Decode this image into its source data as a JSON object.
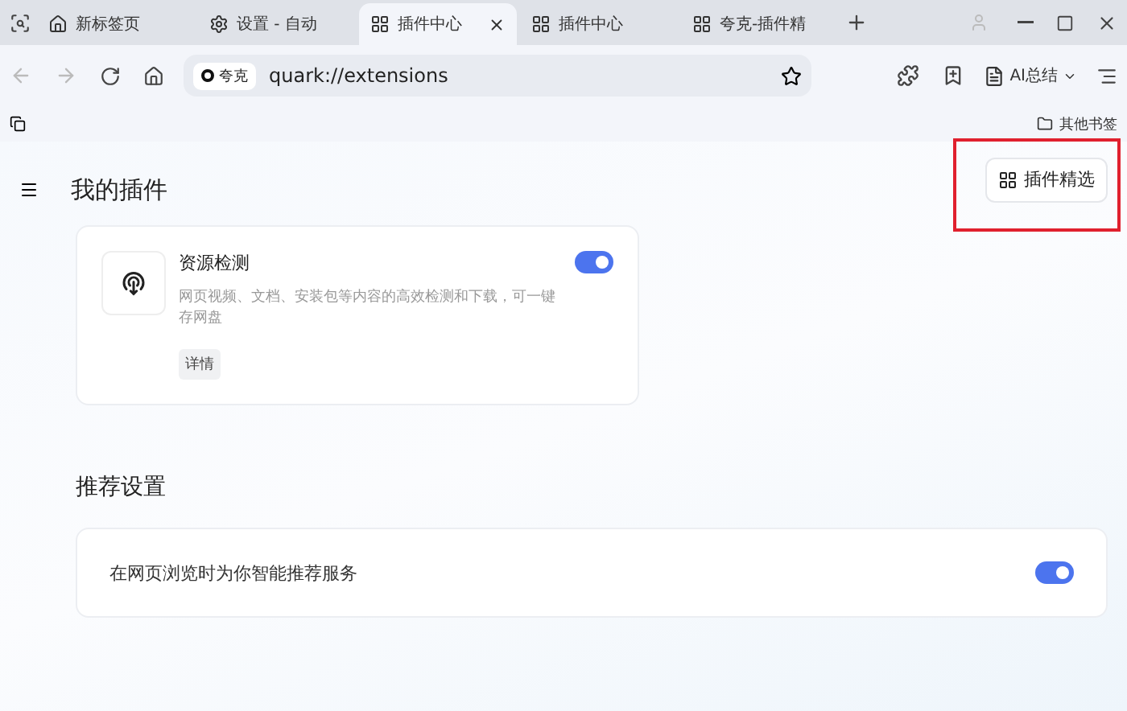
{
  "tabs": [
    {
      "label": "新标签页",
      "kind": "home",
      "selected": false
    },
    {
      "label": "设置 - 自动",
      "kind": "settings",
      "selected": false
    },
    {
      "label": "插件中心",
      "kind": "grid",
      "selected": true
    },
    {
      "label": "插件中心",
      "kind": "grid",
      "selected": false
    },
    {
      "label": "夸克-插件精",
      "kind": "grid",
      "selected": false
    }
  ],
  "address": {
    "badge": "夸克",
    "url": "quark://extensions"
  },
  "ai_button": "AI总结",
  "bookmarks": [
    {
      "label": "其他书签"
    }
  ],
  "page": {
    "title": "我的插件",
    "featured_button": "插件精选",
    "featured_highlighted": true,
    "extensions": [
      {
        "name": "资源检测",
        "description": "网页视频、文档、安装包等内容的高效检测和下载，可一键存网盘",
        "details": "详情",
        "on": true
      }
    ],
    "section_title": "推荐设置",
    "settings": [
      {
        "label": "在网页浏览时为你智能推荐服务",
        "on": true
      }
    ]
  }
}
